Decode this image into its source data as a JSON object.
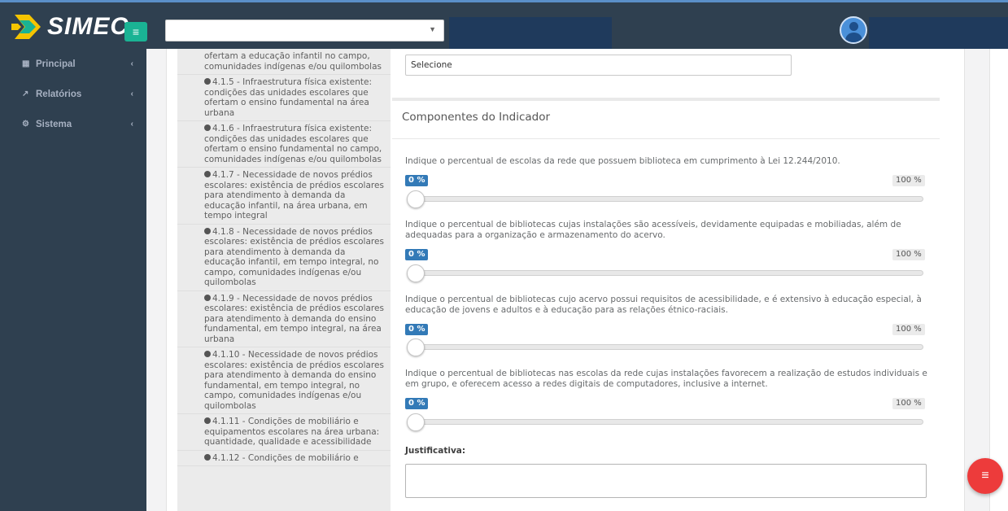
{
  "header": {
    "logo_text": "SIMEC",
    "menu_icon": "hamburger-icon",
    "top_select_value": "",
    "avatar_icon": "user-icon"
  },
  "sidebar": {
    "items": [
      {
        "label": "Principal",
        "icon": "grid-icon"
      },
      {
        "label": "Relatórios",
        "icon": "line-chart-icon"
      },
      {
        "label": "Sistema",
        "icon": "cogs-icon"
      }
    ]
  },
  "indicator_list": [
    "ofertam a educação infantil no campo, comunidades indígenas e/ou quilombolas",
    "4.1.5 - Infraestrutura física existente: condições das unidades escolares que ofertam o ensino fundamental na área urbana",
    "4.1.6 - Infraestrutura física existente: condições das unidades escolares que ofertam o ensino fundamental no campo, comunidades indígenas e/ou quilombolas",
    "4.1.7 - Necessidade de novos prédios escolares: existência de prédios escolares para atendimento à demanda da educação infantil, na área urbana, em tempo integral",
    "4.1.8 - Necessidade de novos prédios escolares: existência de prédios escolares para atendimento à demanda da educação infantil, em tempo integral, no campo, comunidades indígenas e/ou quilombolas",
    "4.1.9 - Necessidade de novos prédios escolares: existência de prédios escolares para atendimento à demanda do ensino fundamental, em tempo integral, na área urbana",
    "4.1.10 - Necessidade de novos prédios escolares: existência de prédios escolares para atendimento à demanda do ensino fundamental, em tempo integral, no campo, comunidades indígenas e/ou quilombolas",
    "4.1.11 - Condições de mobiliário e equipamentos escolares na área urbana: quantidade, qualidade e acessibilidade",
    "4.1.12 - Condições de mobiliário e"
  ],
  "form": {
    "select_value": "Selecione",
    "section_title": "Componentes do Indicador",
    "questions": [
      {
        "text": "Indique o percentual de escolas da rede que possuem biblioteca em cumprimento à Lei 12.244/2010.",
        "min_label": "0 %",
        "max_label": "100 %",
        "value": 0
      },
      {
        "text": "Indique o percentual de bibliotecas cujas instalações são acessíveis, devidamente equipadas e mobiliadas, além de adequadas para a organização e armazenamento do acervo.",
        "min_label": "0 %",
        "max_label": "100 %",
        "value": 0
      },
      {
        "text": "Indique o percentual de bibliotecas cujo acervo possui requisitos de acessibilidade, e é extensivo à educação especial, à educação de jovens e adultos e à educação para as relações étnico-raciais.",
        "min_label": "0 %",
        "max_label": "100 %",
        "value": 0
      },
      {
        "text": "Indique o percentual de bibliotecas nas escolas da rede cujas instalações favorecem a realização de estudos individuais e em grupo, e oferecem acesso a redes digitais de computadores, inclusive a internet.",
        "min_label": "0 %",
        "max_label": "100 %",
        "value": 0
      }
    ],
    "justification_label": "Justificativa:",
    "justification_value": ""
  },
  "fab_icon": "list-icon",
  "colors": {
    "topbar": "#2f4050",
    "sidebar": "#2f4050",
    "accent_green": "#1ab394",
    "badge_blue": "#337ab7",
    "fab_red": "#ed3b3b"
  }
}
